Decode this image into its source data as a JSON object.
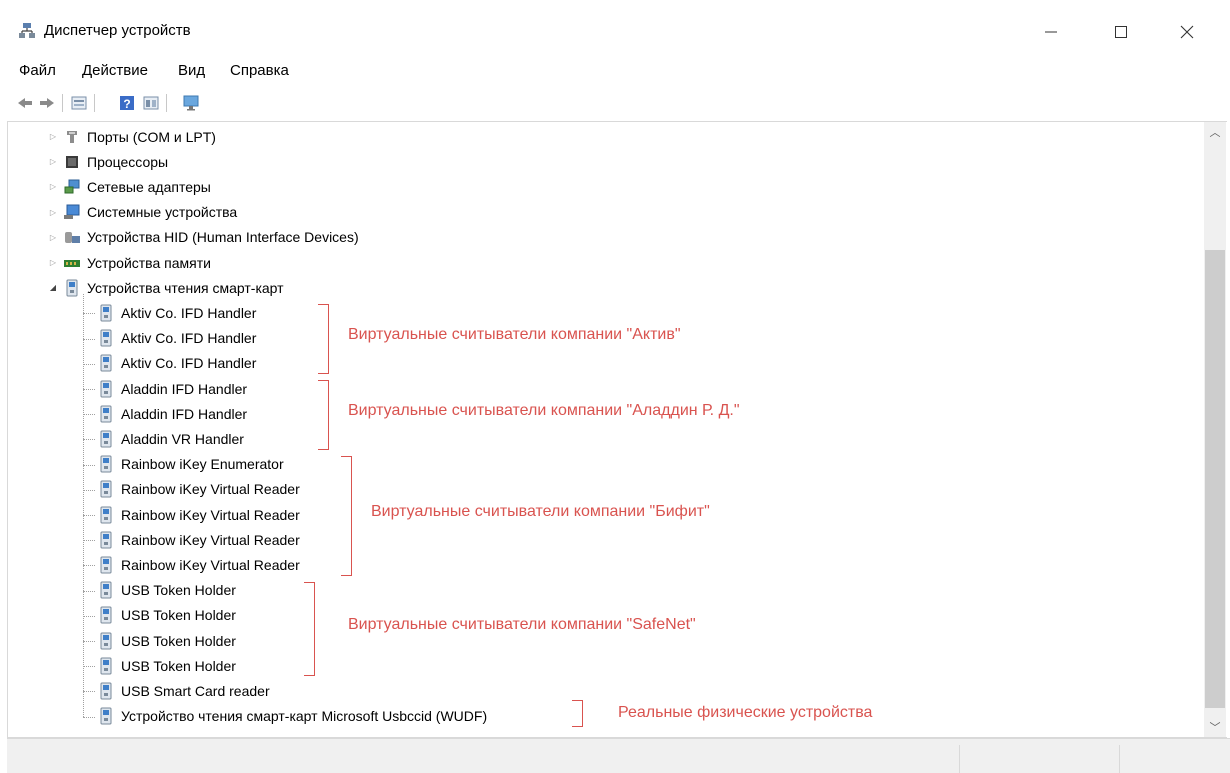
{
  "window": {
    "title": "Диспетчер устройств",
    "app_icon": "device-manager-icon",
    "controls": {
      "minimize": "—",
      "maximize": "☐",
      "close": "✕"
    }
  },
  "menu": {
    "file": "Файл",
    "action": "Действие",
    "view": "Вид",
    "help": "Справка"
  },
  "toolbar": {
    "icons": [
      "back-arrow-icon",
      "forward-arrow-icon",
      "properties-icon",
      "help-icon",
      "view-icon",
      "monitor-icon"
    ]
  },
  "tree": {
    "categories": [
      {
        "label": "Порты (COM и LPT)",
        "icon": "port-icon",
        "expanded": false
      },
      {
        "label": "Процессоры",
        "icon": "processor-icon",
        "expanded": false
      },
      {
        "label": "Сетевые адаптеры",
        "icon": "network-adapter-icon",
        "expanded": false
      },
      {
        "label": "Системные устройства",
        "icon": "system-device-icon",
        "expanded": false
      },
      {
        "label": "Устройства HID (Human Interface Devices)",
        "icon": "hid-icon",
        "expanded": false
      },
      {
        "label": "Устройства памяти",
        "icon": "memory-icon",
        "expanded": false
      },
      {
        "label": "Устройства чтения смарт-карт",
        "icon": "smartcard-reader-icon",
        "expanded": true
      }
    ],
    "children": [
      "Aktiv Co. IFD Handler",
      "Aktiv Co. IFD Handler",
      "Aktiv Co. IFD Handler",
      "Aladdin IFD Handler",
      "Aladdin IFD Handler",
      "Aladdin VR Handler",
      "Rainbow iKey Enumerator",
      "Rainbow iKey Virtual Reader",
      "Rainbow iKey Virtual Reader",
      "Rainbow iKey Virtual Reader",
      "Rainbow iKey Virtual Reader",
      "USB Token Holder",
      "USB Token Holder",
      "USB Token Holder",
      "USB Token Holder",
      "USB Smart Card reader",
      "Устройство чтения смарт-карт Microsoft Usbccid (WUDF)"
    ]
  },
  "annotations": [
    "Виртуальные считыватели компании \"Актив\"",
    "Виртуальные считыватели компании \"Аладдин Р. Д.\"",
    "Виртуальные считыватели компании \"Бифит\"",
    "Виртуальные считыватели компании \"SafeNet\"",
    "Реальные физические устройства"
  ],
  "colors": {
    "annotation": "#d9534f",
    "scroll_thumb": "#cdcdcd"
  }
}
